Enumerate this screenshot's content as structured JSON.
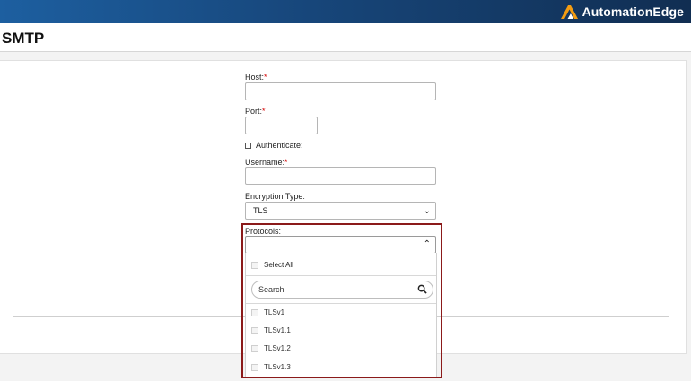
{
  "header": {
    "brand": "AutomationEdge",
    "logo_icon": "automationedge-logo-icon"
  },
  "page": {
    "title": "SMTP"
  },
  "form": {
    "host": {
      "label": "Host:",
      "required_mark": "*",
      "value": ""
    },
    "port": {
      "label": "Port:",
      "required_mark": "*",
      "value": ""
    },
    "authenticate": {
      "label": "Authenticate:",
      "checked": false
    },
    "username": {
      "label": "Username:",
      "required_mark": "*",
      "value": ""
    },
    "encryption": {
      "label": "Encryption Type:",
      "selected": "TLS"
    },
    "protocols": {
      "label": "Protocols:",
      "selected": ""
    }
  },
  "protocols_dropdown": {
    "select_all": "Select All",
    "search_placeholder": "Search",
    "options": [
      "TLSv1",
      "TLSv1.1",
      "TLSv1.2",
      "TLSv1.3"
    ]
  },
  "colors": {
    "header_start": "#1d5fa0",
    "header_end": "#112e52",
    "highlight": "#8b1a1a",
    "logo_orange": "#f39c12"
  }
}
